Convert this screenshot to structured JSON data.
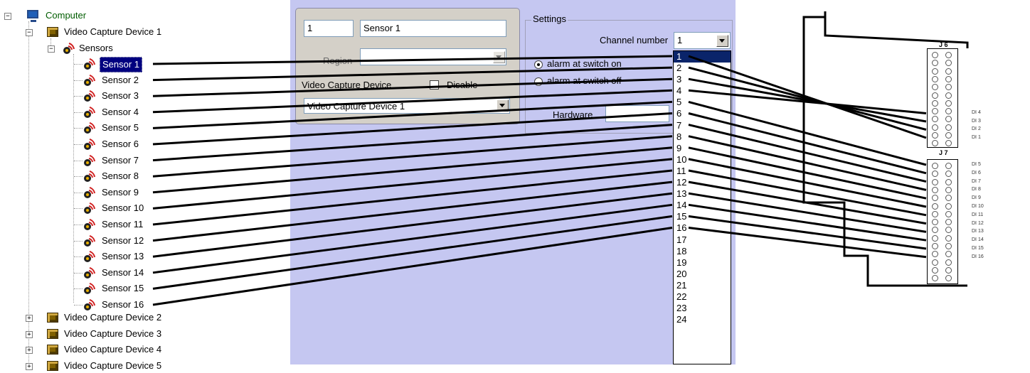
{
  "tree": {
    "computer": "Computer",
    "device1": "Video Capture Device 1",
    "sensors_folder": "Sensors",
    "sensors": [
      "Sensor 1",
      "Sensor 2",
      "Sensor 3",
      "Sensor 4",
      "Sensor 5",
      "Sensor 6",
      "Sensor 7",
      "Sensor 8",
      "Sensor 9",
      "Sensor 10",
      "Sensor 11",
      "Sensor 12",
      "Sensor 13",
      "Sensor 14",
      "Sensor 15",
      "Sensor 16"
    ],
    "other_devices": [
      "Video Capture Device 2",
      "Video Capture Device 3",
      "Video Capture Device 4",
      "Video Capture Device 5"
    ]
  },
  "form": {
    "id_value": "1",
    "name_value": "Sensor 1",
    "region_label": "Region",
    "region_value": "",
    "vcd_label": "Video Capture Device",
    "disable_label": "Disable",
    "vcd_value": "Video Capture Device 1"
  },
  "settings": {
    "title": "Settings",
    "channel_label": "Channel number",
    "channel_value": "1",
    "alarm_on": "alarm at switch on",
    "alarm_off": "alarm at switch off",
    "hardware_label": "Hardware",
    "alarm_selected": "on"
  },
  "dropdown": {
    "options": [
      "1",
      "2",
      "3",
      "4",
      "5",
      "6",
      "7",
      "8",
      "9",
      "10",
      "11",
      "12",
      "13",
      "14",
      "15",
      "16",
      "17",
      "18",
      "19",
      "20",
      "21",
      "22",
      "23",
      "24"
    ],
    "selected": "1"
  },
  "diagram": {
    "j6_label": "J 6",
    "j7_label": "J 7",
    "j6_inputs": [
      "DI 4",
      "DI 3",
      "DI 2",
      "DI 1"
    ],
    "j7_inputs": [
      "DI 5",
      "DI 6",
      "DI 7",
      "DI 8",
      "DI 9",
      "DI 10",
      "DI 11",
      "DI 12",
      "DI 13",
      "DI 14",
      "DI 15",
      "DI 16"
    ]
  },
  "colors": {
    "panel_bg": "#c5c7f1",
    "selection": "#000080",
    "dropdown_selection": "#0a246a"
  }
}
